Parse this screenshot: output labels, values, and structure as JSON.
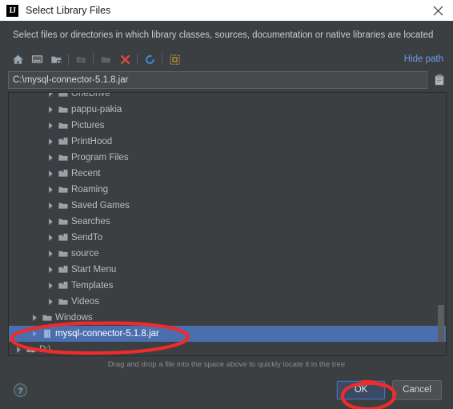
{
  "window": {
    "title": "Select Library Files",
    "logo_text": "IJ",
    "logo_icon": "intellij-idea-icon",
    "close_icon": "close-icon"
  },
  "description": "Select files or directories in which library classes, sources, documentation or native libraries are located",
  "toolbar": {
    "buttons": [
      {
        "name": "home-icon",
        "title": "Home"
      },
      {
        "name": "desktop-icon",
        "title": "Desktop"
      },
      {
        "name": "new-folder-icon",
        "title": "New Folder"
      },
      {
        "name": "collapse-folder-icon",
        "title": "Collapse"
      },
      {
        "name": "open-folder-icon",
        "title": "Open"
      },
      {
        "name": "delete-icon",
        "title": "Delete"
      },
      {
        "name": "refresh-icon",
        "title": "Refresh"
      },
      {
        "name": "show-hidden-files-icon",
        "title": "Show Hidden Files"
      }
    ],
    "hide_path_label": "Hide path"
  },
  "path_field": {
    "value": "C:\\mysql-connector-5.1.8.jar",
    "placeholder": "",
    "paste_icon": "paste-clipboard-icon"
  },
  "tree": {
    "items": [
      {
        "label": "OneDrive",
        "indent": 2,
        "icon": "folder-icon",
        "expandable": true,
        "selected": false,
        "clipped": true
      },
      {
        "label": "pappu-pakia",
        "indent": 2,
        "icon": "folder-icon",
        "expandable": true,
        "selected": false
      },
      {
        "label": "Pictures",
        "indent": 2,
        "icon": "folder-icon",
        "expandable": true,
        "selected": false
      },
      {
        "label": "PrintHood",
        "indent": 2,
        "icon": "folder-shortcut-icon",
        "expandable": true,
        "selected": false
      },
      {
        "label": "Program Files",
        "indent": 2,
        "icon": "folder-icon",
        "expandable": true,
        "selected": false
      },
      {
        "label": "Recent",
        "indent": 2,
        "icon": "folder-shortcut-icon",
        "expandable": true,
        "selected": false
      },
      {
        "label": "Roaming",
        "indent": 2,
        "icon": "folder-icon",
        "expandable": true,
        "selected": false
      },
      {
        "label": "Saved Games",
        "indent": 2,
        "icon": "folder-icon",
        "expandable": true,
        "selected": false
      },
      {
        "label": "Searches",
        "indent": 2,
        "icon": "folder-icon",
        "expandable": true,
        "selected": false
      },
      {
        "label": "SendTo",
        "indent": 2,
        "icon": "folder-shortcut-icon",
        "expandable": true,
        "selected": false
      },
      {
        "label": "source",
        "indent": 2,
        "icon": "folder-icon",
        "expandable": true,
        "selected": false
      },
      {
        "label": "Start Menu",
        "indent": 2,
        "icon": "folder-shortcut-icon",
        "expandable": true,
        "selected": false
      },
      {
        "label": "Templates",
        "indent": 2,
        "icon": "folder-shortcut-icon",
        "expandable": true,
        "selected": false
      },
      {
        "label": "Videos",
        "indent": 2,
        "icon": "folder-icon",
        "expandable": true,
        "selected": false
      },
      {
        "label": "Windows",
        "indent": 1,
        "icon": "folder-icon",
        "expandable": true,
        "selected": false
      },
      {
        "label": "mysql-connector-5.1.8.jar",
        "indent": 1,
        "icon": "jar-archive-icon",
        "expandable": true,
        "selected": true
      },
      {
        "label": "D:\\",
        "indent": 0,
        "icon": "drive-icon",
        "expandable": true,
        "selected": false,
        "clipped": true
      }
    ]
  },
  "hint": "Drag and drop a file into the space above to quickly locate it in the tree",
  "footer": {
    "help_icon": "help-question-icon",
    "ok_label": "OK",
    "cancel_label": "Cancel"
  },
  "colors": {
    "dialog_bg": "#3c3f41",
    "titlebar_bg": "#ffffff",
    "selection_blue": "#4b6eaf",
    "link_blue": "#6c9ce6",
    "annotation_red": "#ef2b2b",
    "folder_blue_grey": "#96a2ac"
  },
  "annotations": [
    {
      "name": "red-circle-selected-file",
      "shape": "ellipse"
    },
    {
      "name": "red-circle-ok-button",
      "shape": "ellipse"
    }
  ]
}
